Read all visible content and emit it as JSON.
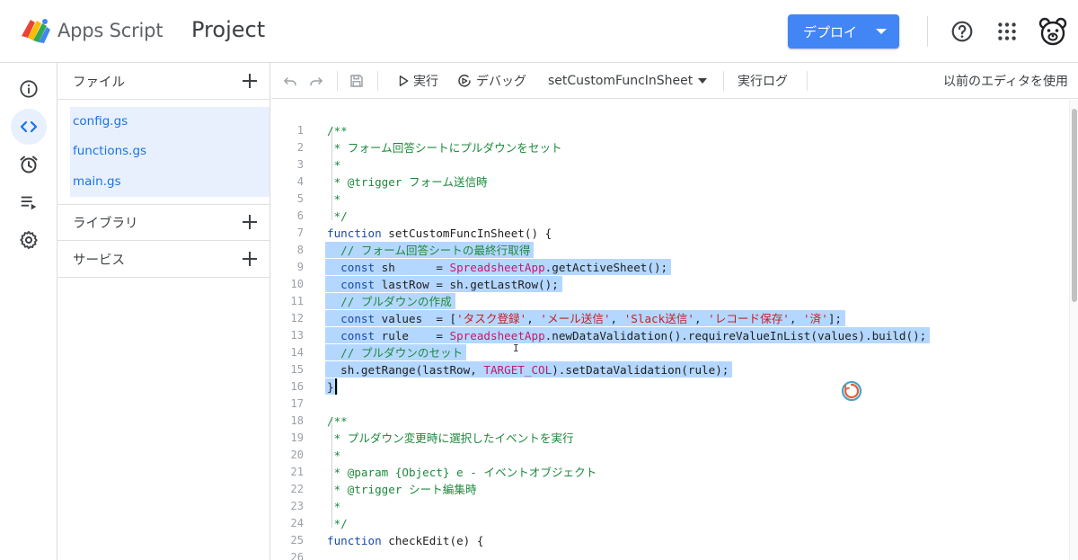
{
  "header": {
    "app_name": "Apps Script",
    "project_name": "Project",
    "deploy_label": "デプロイ"
  },
  "icons": {
    "help": "help-circle-icon",
    "apps": "apps-grid-icon",
    "avatar": "bear-avatar-icon"
  },
  "rail": {
    "items": [
      "info-icon",
      "code-icon",
      "alarm-clock-icon",
      "executions-icon",
      "gear-icon"
    ],
    "active_index": 1
  },
  "files": {
    "section_label": "ファイル",
    "items": [
      "config.gs",
      "functions.gs",
      "main.gs"
    ],
    "libraries_label": "ライブラリ",
    "services_label": "サービス"
  },
  "toolbar": {
    "run_label": "実行",
    "debug_label": "デバッグ",
    "function_name": "setCustomFuncInSheet",
    "log_label": "実行ログ",
    "legacy_label": "以前のエディタを使用"
  },
  "colors": {
    "accent": "#4285f4",
    "selection": "#b4d7ff",
    "active_rail": "#e8f0fe",
    "file_link": "#1a73e8"
  },
  "editor": {
    "lines": [
      {
        "n": "1",
        "sel": false,
        "tokens": [
          [
            "com",
            "/**"
          ]
        ]
      },
      {
        "n": "2",
        "sel": false,
        "tokens": [
          [
            "com",
            " * フォーム回答シートにプルダウンをセット"
          ]
        ]
      },
      {
        "n": "3",
        "sel": false,
        "tokens": [
          [
            "com",
            " *"
          ]
        ]
      },
      {
        "n": "4",
        "sel": false,
        "tokens": [
          [
            "com",
            " * @trigger フォーム送信時"
          ]
        ]
      },
      {
        "n": "5",
        "sel": false,
        "tokens": [
          [
            "com",
            " *"
          ]
        ]
      },
      {
        "n": "6",
        "sel": false,
        "tokens": [
          [
            "com",
            " */"
          ]
        ]
      },
      {
        "n": "7",
        "sel": false,
        "tokens": [
          [
            "kw",
            "function "
          ],
          [
            "fn",
            "setCustomFuncInSheet() {"
          ]
        ]
      },
      {
        "n": "8",
        "sel": true,
        "tokens": [
          [
            "plain",
            "  "
          ],
          [
            "com",
            "// フォーム回答シートの最終行取得"
          ]
        ]
      },
      {
        "n": "9",
        "sel": true,
        "tokens": [
          [
            "plain",
            "  "
          ],
          [
            "kw",
            "const "
          ],
          [
            "plain",
            "sh      = "
          ],
          [
            "cls",
            "SpreadsheetApp"
          ],
          [
            "plain",
            ".getActiveSheet();"
          ]
        ]
      },
      {
        "n": "10",
        "sel": true,
        "tokens": [
          [
            "plain",
            "  "
          ],
          [
            "kw",
            "const "
          ],
          [
            "plain",
            "lastRow = sh.getLastRow();"
          ]
        ]
      },
      {
        "n": "11",
        "sel": true,
        "tokens": [
          [
            "plain",
            "  "
          ],
          [
            "com",
            "// プルダウンの作成"
          ]
        ]
      },
      {
        "n": "12",
        "sel": true,
        "tokens": [
          [
            "plain",
            "  "
          ],
          [
            "kw",
            "const "
          ],
          [
            "plain",
            "values  = ["
          ],
          [
            "str",
            "'タスク登録'"
          ],
          [
            "plain",
            ", "
          ],
          [
            "str",
            "'メール送信'"
          ],
          [
            "plain",
            ", "
          ],
          [
            "str",
            "'Slack送信'"
          ],
          [
            "plain",
            ", "
          ],
          [
            "str",
            "'レコード保存'"
          ],
          [
            "plain",
            ", "
          ],
          [
            "str",
            "'済'"
          ],
          [
            "plain",
            "];"
          ]
        ]
      },
      {
        "n": "13",
        "sel": true,
        "tokens": [
          [
            "plain",
            "  "
          ],
          [
            "kw",
            "const "
          ],
          [
            "plain",
            "rule    = "
          ],
          [
            "cls",
            "SpreadsheetApp"
          ],
          [
            "plain",
            ".newDataValidation().requireValueInList(values).build();"
          ]
        ]
      },
      {
        "n": "14",
        "sel": true,
        "tokens": [
          [
            "plain",
            "  "
          ],
          [
            "com",
            "// プルダウンのセット"
          ]
        ]
      },
      {
        "n": "15",
        "sel": true,
        "tokens": [
          [
            "plain",
            "  sh.getRange(lastRow, "
          ],
          [
            "const",
            "TARGET_COL"
          ],
          [
            "plain",
            ").setDataValidation(rule);"
          ]
        ]
      },
      {
        "n": "16",
        "sel": true,
        "tokens": [
          [
            "plain",
            "}"
          ]
        ]
      },
      {
        "n": "17",
        "sel": false,
        "tokens": []
      },
      {
        "n": "18",
        "sel": false,
        "tokens": [
          [
            "com",
            "/**"
          ]
        ]
      },
      {
        "n": "19",
        "sel": false,
        "tokens": [
          [
            "com",
            " * プルダウン変更時に選択したイベントを実行"
          ]
        ]
      },
      {
        "n": "20",
        "sel": false,
        "tokens": [
          [
            "com",
            " *"
          ]
        ]
      },
      {
        "n": "21",
        "sel": false,
        "tokens": [
          [
            "com",
            " * @param {Object} e - イベントオブジェクト"
          ]
        ]
      },
      {
        "n": "22",
        "sel": false,
        "tokens": [
          [
            "com",
            " * @trigger シート編集時"
          ]
        ]
      },
      {
        "n": "23",
        "sel": false,
        "tokens": [
          [
            "com",
            " *"
          ]
        ]
      },
      {
        "n": "24",
        "sel": false,
        "tokens": [
          [
            "com",
            " */"
          ]
        ]
      },
      {
        "n": "25",
        "sel": false,
        "tokens": [
          [
            "kw",
            "function "
          ],
          [
            "fn",
            "checkEdit(e) {"
          ]
        ]
      },
      {
        "n": "26",
        "sel": false,
        "tokens": []
      }
    ]
  }
}
